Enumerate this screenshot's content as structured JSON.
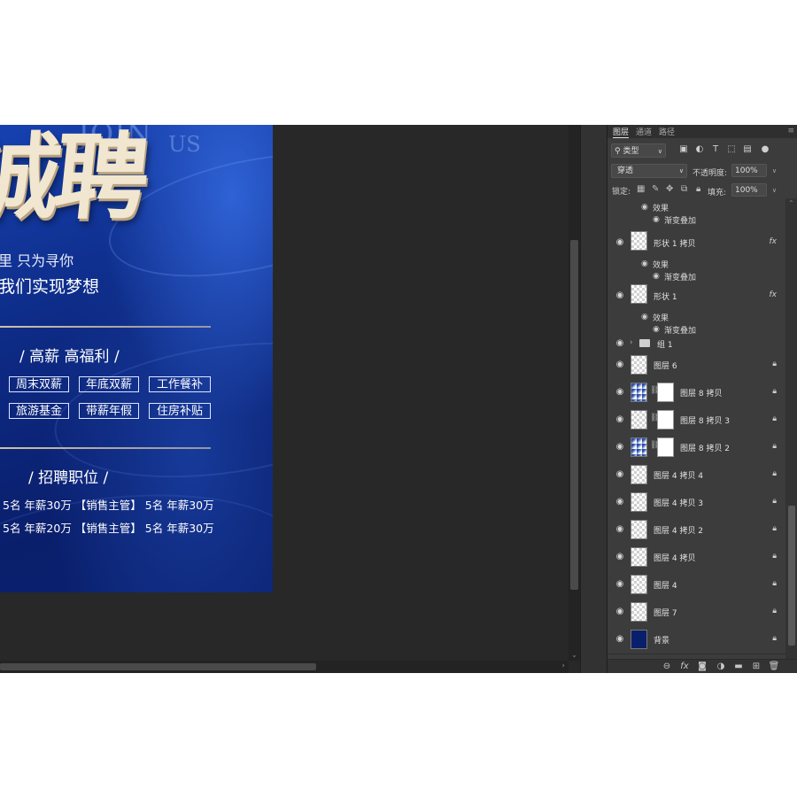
{
  "poster": {
    "join": "JOIN",
    "us": "US",
    "big_title": "诚聘",
    "slogan1": "里 只为寻你",
    "slogan2": "我们实现梦想",
    "benefits_title": "/ 高薪 高福利 /",
    "benefit_tags": [
      "周末双薪",
      "年底双薪",
      "工作餐补",
      "旅游基金",
      "带薪年假",
      "住房补贴"
    ],
    "jobs_title": "/ 招聘职位 /",
    "job_lines": [
      "5名 年薪30万   【销售主管】 5名 年薪30万",
      "5名 年薪20万   【销售主管】 5名 年薪30万"
    ]
  },
  "panel": {
    "tabs": [
      "图层",
      "通道",
      "路径"
    ],
    "filter_kind": "类型",
    "blend_mode": "穿透",
    "opacity_label": "不透明度:",
    "opacity_value": "100%",
    "lock_label": "锁定:",
    "fill_label": "填充:",
    "fill_value": "100%",
    "effects_label": "效果",
    "gradient_overlay_label": "渐变叠加",
    "fx_label": "fx",
    "layers": [
      {
        "name": "形状 1 拷贝"
      },
      {
        "name": "形状 1"
      },
      {
        "name": "组 1"
      },
      {
        "name": "图层 6"
      },
      {
        "name": "图层 8 拷贝"
      },
      {
        "name": "图层 8 拷贝 3"
      },
      {
        "name": "图层 8 拷贝 2"
      },
      {
        "name": "图层 4 拷贝 4"
      },
      {
        "name": "图层 4 拷贝 3"
      },
      {
        "name": "图层 4 拷贝 2"
      },
      {
        "name": "图层 4 拷贝"
      },
      {
        "name": "图层 4"
      },
      {
        "name": "图层 7"
      },
      {
        "name": "背景"
      }
    ]
  },
  "colors": {
    "poster_blue": "#0d2a84",
    "accent_gold": "#f1e6cf",
    "background_thumb": "#0a1f6c"
  },
  "icons": [
    "eye-icon",
    "lock-icon",
    "folder-icon",
    "chain-icon",
    "link-layers-icon",
    "fx-icon",
    "mask-icon",
    "adjustment-icon",
    "new-group-icon",
    "new-layer-icon",
    "trash-icon"
  ]
}
